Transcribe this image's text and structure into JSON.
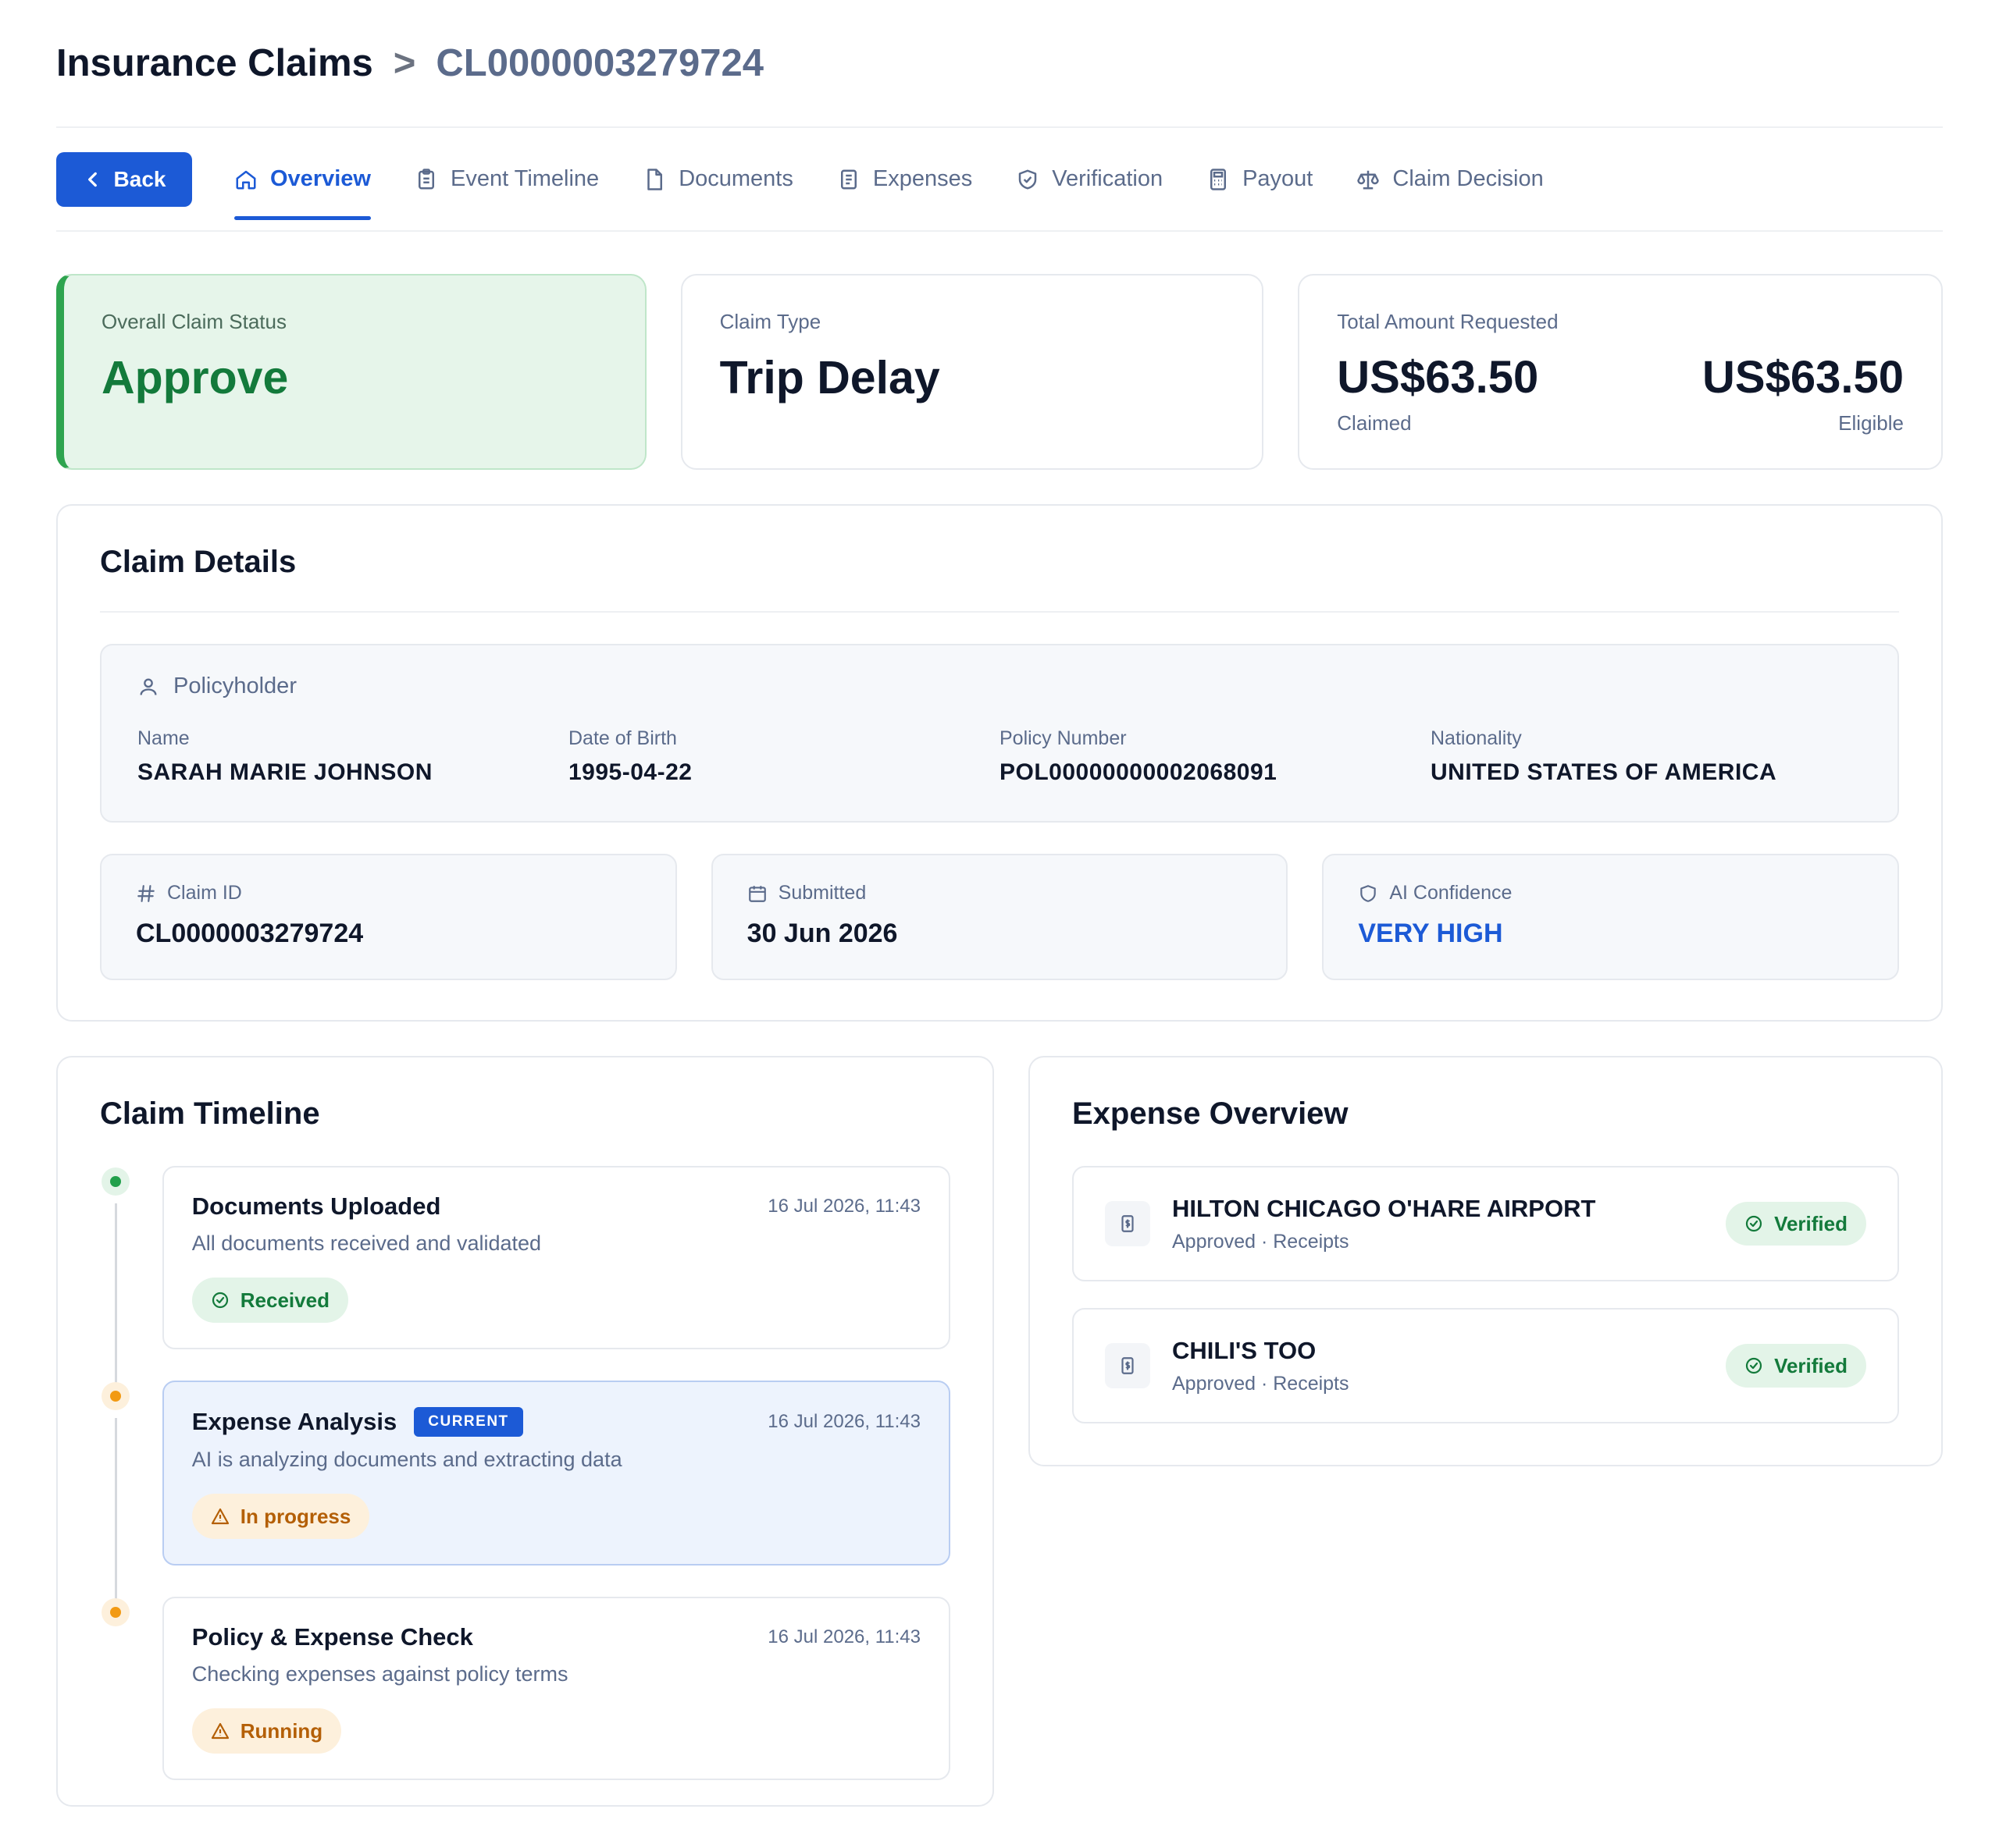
{
  "breadcrumb": {
    "root": "Insurance Claims",
    "separator": ">",
    "current": "CL0000003279724"
  },
  "nav": {
    "back_label": "Back",
    "tabs": [
      {
        "label": "Overview",
        "icon": "home-icon",
        "active": true
      },
      {
        "label": "Event Timeline",
        "icon": "clipboard-icon",
        "active": false
      },
      {
        "label": "Documents",
        "icon": "document-icon",
        "active": false
      },
      {
        "label": "Expenses",
        "icon": "receipt-icon",
        "active": false
      },
      {
        "label": "Verification",
        "icon": "shield-check-icon",
        "active": false
      },
      {
        "label": "Payout",
        "icon": "calculator-icon",
        "active": false
      },
      {
        "label": "Claim Decision",
        "icon": "scale-icon",
        "active": false
      }
    ]
  },
  "summary": {
    "status": {
      "label": "Overall Claim Status",
      "value": "Approve",
      "color": "#137a3b"
    },
    "type": {
      "label": "Claim Type",
      "value": "Trip Delay"
    },
    "amount": {
      "label": "Total Amount Requested",
      "claimed_value": "US$63.50",
      "claimed_label": "Claimed",
      "eligible_value": "US$63.50",
      "eligible_label": "Eligible"
    }
  },
  "details": {
    "title": "Claim Details",
    "policyholder": {
      "heading": "Policyholder",
      "fields": [
        {
          "label": "Name",
          "value": "SARAH MARIE JOHNSON"
        },
        {
          "label": "Date of Birth",
          "value": "1995-04-22"
        },
        {
          "label": "Policy Number",
          "value": "POL00000000002068091"
        },
        {
          "label": "Nationality",
          "value": "UNITED STATES OF AMERICA"
        }
      ]
    },
    "meta": [
      {
        "label": "Claim ID",
        "value": "CL0000003279724",
        "icon": "hash-icon"
      },
      {
        "label": "Submitted",
        "value": "30 Jun 2026",
        "icon": "calendar-icon"
      },
      {
        "label": "AI Confidence",
        "value": "VERY HIGH",
        "icon": "shield-icon"
      }
    ]
  },
  "timeline": {
    "title": "Claim Timeline",
    "items": [
      {
        "title": "Documents Uploaded",
        "time": "16 Jul 2026, 11:43",
        "desc": "All documents received and validated",
        "status": "Received",
        "tone": "green",
        "current": false
      },
      {
        "title": "Expense Analysis",
        "tag": "CURRENT",
        "time": "16 Jul 2026, 11:43",
        "desc": "AI is analyzing documents and extracting data",
        "status": "In progress",
        "tone": "amber",
        "current": true
      },
      {
        "title": "Policy & Expense Check",
        "time": "16 Jul 2026, 11:43",
        "desc": "Checking expenses against policy terms",
        "status": "Running",
        "tone": "amber",
        "current": false
      }
    ]
  },
  "expenses": {
    "title": "Expense Overview",
    "items": [
      {
        "name": "HILTON CHICAGO O'HARE AIRPORT",
        "sub": "Approved · Receipts",
        "badge": "Verified"
      },
      {
        "name": "CHILI'S TOO",
        "sub": "Approved · Receipts",
        "badge": "Verified"
      }
    ]
  },
  "colors": {
    "accent": "#1c5ad6",
    "success": "#137a3b",
    "warning": "#b45f06"
  }
}
